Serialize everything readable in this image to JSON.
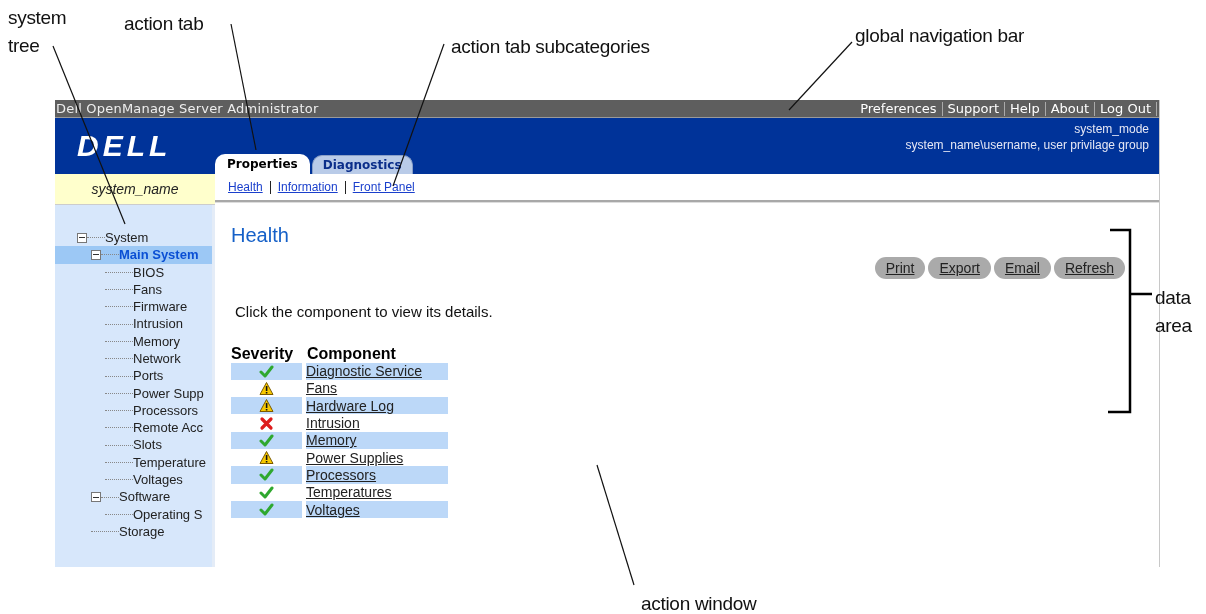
{
  "callouts": [
    {
      "text": "system tree"
    },
    {
      "text": "action tab"
    },
    {
      "text": "action tab subcategories"
    },
    {
      "text": "global navigation bar"
    },
    {
      "text": "data area"
    },
    {
      "text": "action window"
    }
  ],
  "window": {
    "title": "Dell OpenManage Server Administrator"
  },
  "global_nav": [
    "Preferences",
    "Support",
    "Help",
    "About",
    "Log Out"
  ],
  "header": {
    "logo": "DELL",
    "system_mode": "system_mode",
    "user_line": "system_name\\username, user privilage group"
  },
  "tabs": [
    {
      "label": "Properties",
      "selected": true
    },
    {
      "label": "Diagnostics",
      "selected": false
    }
  ],
  "subcategories": [
    "Health",
    "Information",
    "Front Panel"
  ],
  "system_name": "system_name",
  "tree": [
    {
      "label": "System",
      "expanded": true,
      "selected": false,
      "children": [
        {
          "label": "Main System",
          "expanded": true,
          "selected": true,
          "children": [
            {
              "label": "BIOS",
              "selected": false
            },
            {
              "label": "Fans",
              "selected": false
            },
            {
              "label": "Firmware",
              "selected": false
            },
            {
              "label": "Intrusion",
              "selected": false
            },
            {
              "label": "Memory",
              "selected": false
            },
            {
              "label": "Network",
              "selected": false
            },
            {
              "label": "Ports",
              "selected": false
            },
            {
              "label": "Power Supp",
              "selected": false
            },
            {
              "label": "Processors",
              "selected": false
            },
            {
              "label": "Remote Acc",
              "selected": false
            },
            {
              "label": "Slots",
              "selected": false
            },
            {
              "label": "Temperature",
              "selected": false
            },
            {
              "label": "Voltages",
              "selected": false
            }
          ]
        },
        {
          "label": "Software",
          "expanded": true,
          "selected": false,
          "children": [
            {
              "label": "Operating S",
              "selected": false
            }
          ]
        },
        {
          "label": "Storage",
          "selected": false
        }
      ]
    }
  ],
  "content": {
    "heading": "Health",
    "buttons": [
      "Print",
      "Export",
      "Email",
      "Refresh"
    ],
    "instruction": "Click the component to view its details.",
    "table": {
      "columns": [
        "Severity",
        "Component"
      ],
      "rows": [
        {
          "kind": "ok",
          "component": "Diagnostic Service"
        },
        {
          "kind": "warning",
          "component": "Fans"
        },
        {
          "kind": "warning",
          "component": "Hardware Log"
        },
        {
          "kind": "critical",
          "component": "Intrusion"
        },
        {
          "kind": "ok",
          "component": "Memory"
        },
        {
          "kind": "warning",
          "component": "Power Supplies"
        },
        {
          "kind": "ok",
          "component": "Processors"
        },
        {
          "kind": "ok",
          "component": "Temperatures"
        },
        {
          "kind": "ok",
          "component": "Voltages"
        }
      ]
    }
  }
}
